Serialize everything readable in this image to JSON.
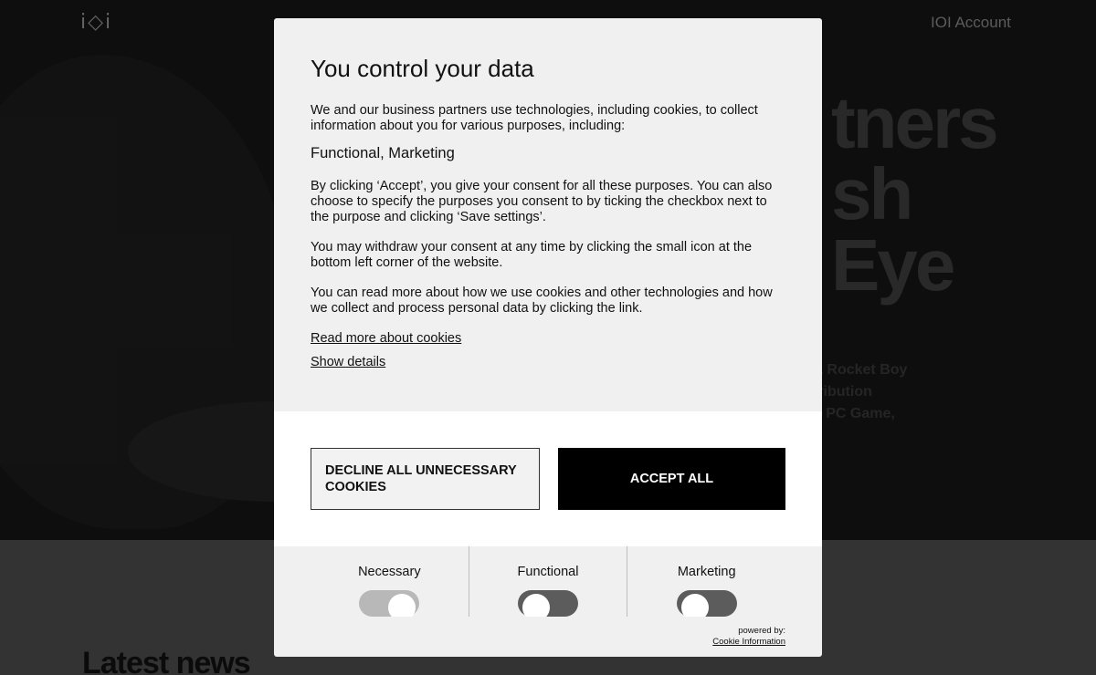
{
  "background": {
    "logo": "i◇i",
    "account_link": "IOI Account",
    "hero_title_lines": [
      "tners",
      "sh",
      "Eye"
    ],
    "hero_text_lines": [
      "A Rocket Boy",
      "tribution",
      "d PC Game,"
    ],
    "news_heading": "Latest news"
  },
  "modal": {
    "title": "You control your data",
    "intro": "We and our business partners use technologies, including cookies, to collect information about you for various purposes, including:",
    "purposes": "Functional, Marketing",
    "consent_text": "By clicking ‘Accept’, you give your consent for all these purposes. You can also choose to specify the purposes you consent to by ticking the checkbox next to the purpose and clicking ‘Save settings’.",
    "withdraw_text": "You may withdraw your consent at any time by clicking the small icon at the bottom left corner of the website.",
    "read_more_text": "You can read more about how we use cookies and other technologies and how we collect and process personal data by clicking the link.",
    "read_more_link": "Read more about cookies",
    "show_details_link": "Show details",
    "decline_button": "DECLINE ALL UNNECESSARY COOKIES",
    "accept_button": "ACCEPT ALL",
    "toggles": [
      {
        "label": "Necessary",
        "state": "on"
      },
      {
        "label": "Functional",
        "state": "off"
      },
      {
        "label": "Marketing",
        "state": "off"
      }
    ],
    "powered_by": "powered by:",
    "powered_brand": "Cookie Information"
  },
  "colors": {
    "accept_bg": "#000000",
    "modal_bg": "#eff0ef",
    "toggle_on": "#b7b8b7",
    "toggle_off": "#5c5c5c"
  }
}
